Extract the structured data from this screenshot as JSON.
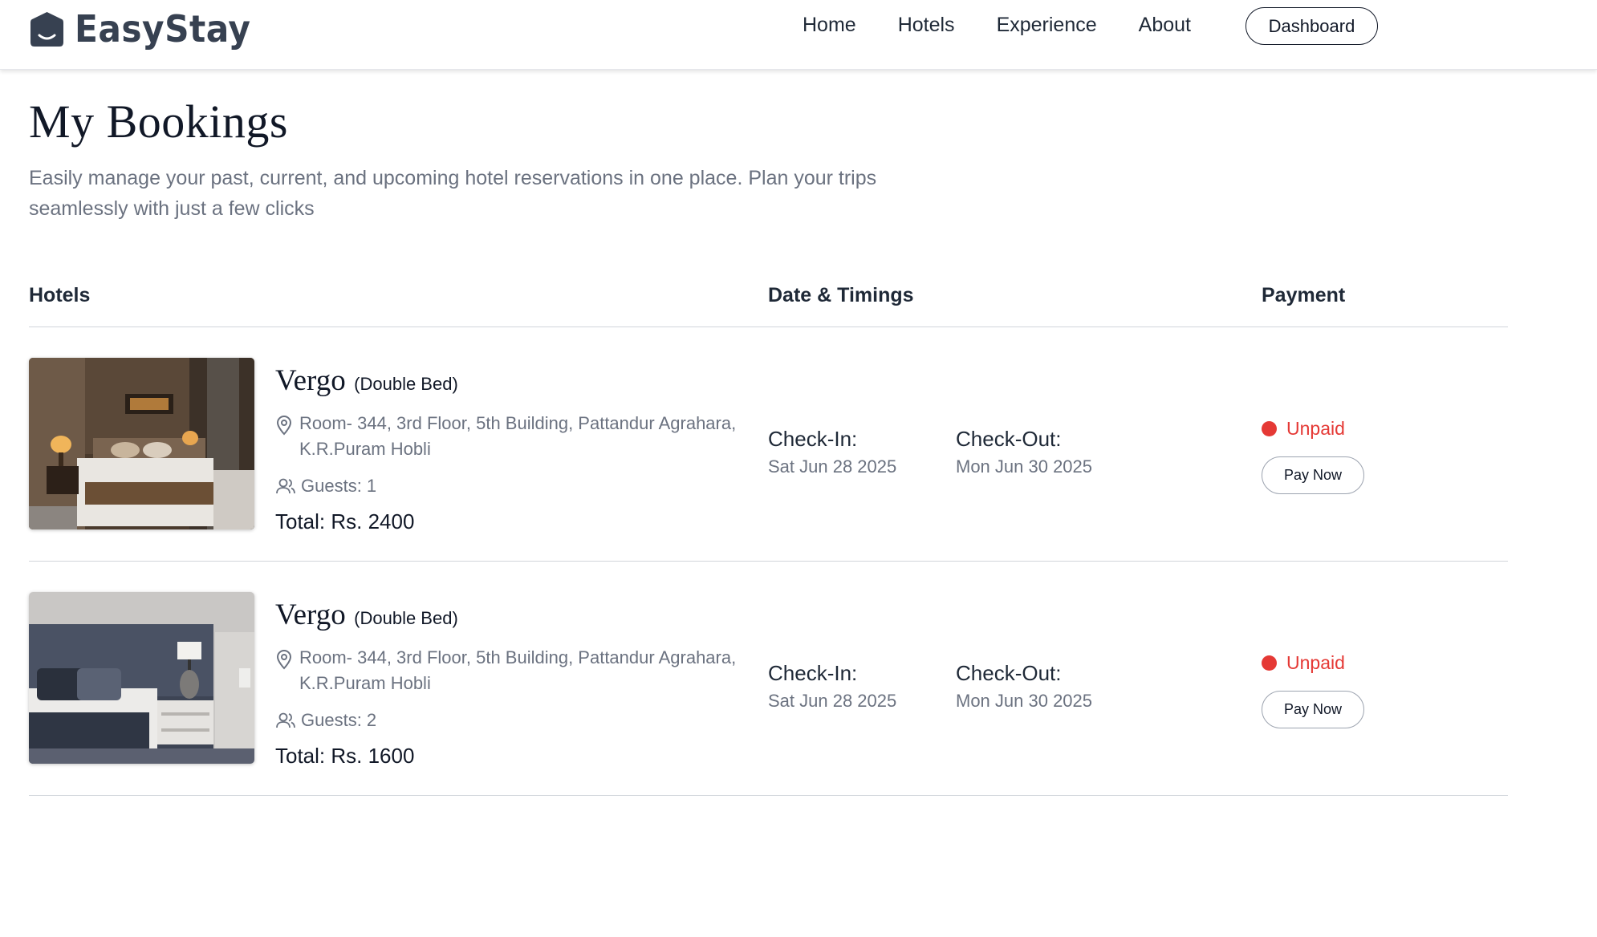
{
  "nav": {
    "brand": "EasyStay",
    "links": [
      "Home",
      "Hotels",
      "Experience",
      "About"
    ],
    "dashboard_label": "Dashboard"
  },
  "header": {
    "title": "My Bookings",
    "subtitle": "Easily manage your past, current, and upcoming hotel reservations in one place. Plan your trips seamlessly with just a few clicks"
  },
  "table": {
    "columns": [
      "Hotels",
      "Date & Timings",
      "Payment"
    ]
  },
  "bookings": [
    {
      "hotel_name": "Vergo",
      "room_type": "(Double Bed)",
      "address": "Room- 344, 3rd Floor, 5th Building, Pattandur Agrahara, K.R.Puram Hobli",
      "guests": "Guests: 1",
      "total": "Total: Rs. 2400",
      "checkin_label": "Check-In:",
      "checkin_date": "Sat Jun 28 2025",
      "checkout_label": "Check-Out:",
      "checkout_date": "Mon Jun 30 2025",
      "status": "Unpaid",
      "pay_label": "Pay Now"
    },
    {
      "hotel_name": "Vergo",
      "room_type": "(Double Bed)",
      "address": "Room- 344, 3rd Floor, 5th Building, Pattandur Agrahara, K.R.Puram Hobli",
      "guests": "Guests: 2",
      "total": "Total: Rs. 1600",
      "checkin_label": "Check-In:",
      "checkin_date": "Sat Jun 28 2025",
      "checkout_label": "Check-Out:",
      "checkout_date": "Mon Jun 30 2025",
      "status": "Unpaid",
      "pay_label": "Pay Now"
    }
  ],
  "colors": {
    "unpaid": "#e53935",
    "muted_text": "#6b7280",
    "divider": "#d1d5db"
  },
  "icons": {
    "logo": "hotel-logo-icon",
    "address": "map-pin-icon",
    "guests": "users-icon"
  }
}
